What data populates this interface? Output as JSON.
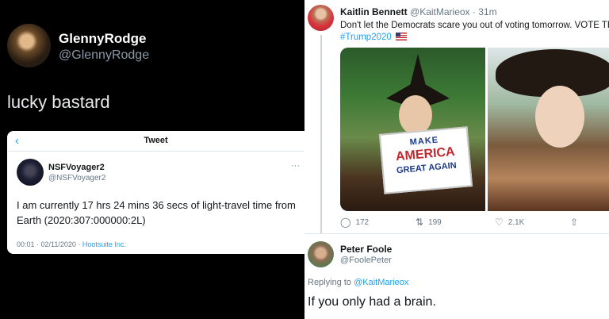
{
  "left_tweet": {
    "name": "GlennyRodge",
    "handle": "@GlennyRodge",
    "text": "lucky bastard",
    "embedded": {
      "header_title": "Tweet",
      "back_icon": "‹",
      "name": "NSFVoyager2",
      "handle": "@NSFVoyager2",
      "more": "···",
      "body": "I am currently 17 hrs 24 mins 36 secs of light-travel time from Earth (2020:307:000000:2L)",
      "timestamp": "00:01 · 02/11/2020 · ",
      "source": "Hootsuite Inc."
    }
  },
  "right_tweet": {
    "name": "Kaitlin Bennett",
    "handle": "@KaitMarieox · 31m",
    "text": "Don't let the Democrats scare you out of voting tomorrow. VOTE TRUMP!",
    "hashtag": "#Trump2020",
    "sign": {
      "line1": "MAKE",
      "line2": "AMERICA",
      "line3": "GREAT AGAIN"
    },
    "actions": {
      "reply_count": "172",
      "retweet_count": "199",
      "like_count": "2.1K"
    }
  },
  "reply": {
    "name": "Peter Foole",
    "handle": "@FoolePeter",
    "replying_prefix": "Replying to ",
    "replying_to": "@KaitMarieox",
    "text": "If you only had a brain."
  },
  "colors": {
    "link": "#1da1f2",
    "muted": "#657786",
    "dark_bg": "#000000"
  }
}
